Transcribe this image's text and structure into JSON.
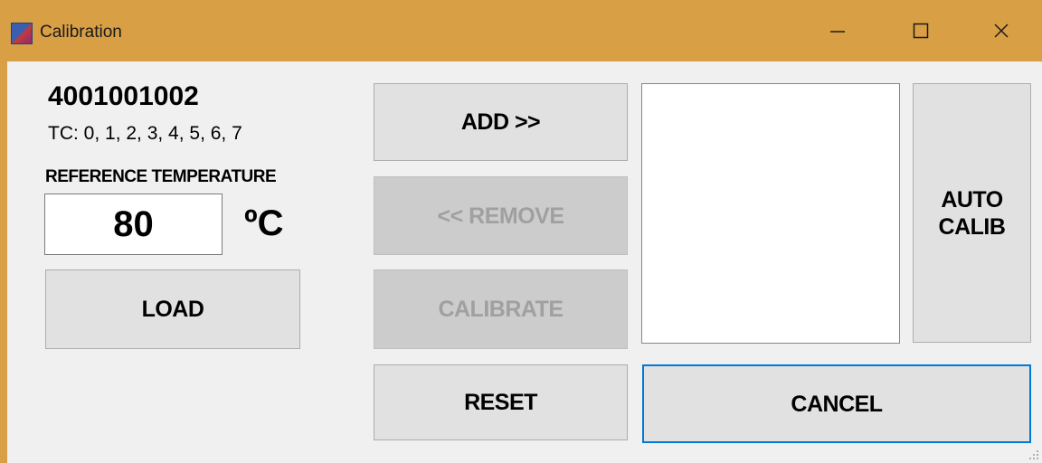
{
  "window": {
    "title": "Calibration",
    "icon": "app-icon",
    "controls": {
      "minimize": "minimize-icon",
      "maximize": "maximize-icon",
      "close": "close-icon"
    }
  },
  "device": {
    "serial": "4001001002",
    "tc_list": "TC: 0, 1, 2, 3, 4, 5, 6, 7"
  },
  "reference": {
    "label": "REFERENCE TEMPERATURE",
    "value": "80",
    "unit": "ºC"
  },
  "buttons": {
    "load": "LOAD",
    "add": "ADD >>",
    "remove": "<< REMOVE",
    "calibrate": "CALIBRATE",
    "reset": "RESET",
    "auto_calib_line1": "AUTO",
    "auto_calib_line2": "CALIB",
    "cancel": "CANCEL"
  },
  "list": {
    "items": []
  },
  "colors": {
    "titlebar": "#d99f45",
    "client": "#f0f0f0",
    "button": "#e1e1e1",
    "button_disabled": "#cccccc",
    "focus_border": "#0078d7"
  }
}
